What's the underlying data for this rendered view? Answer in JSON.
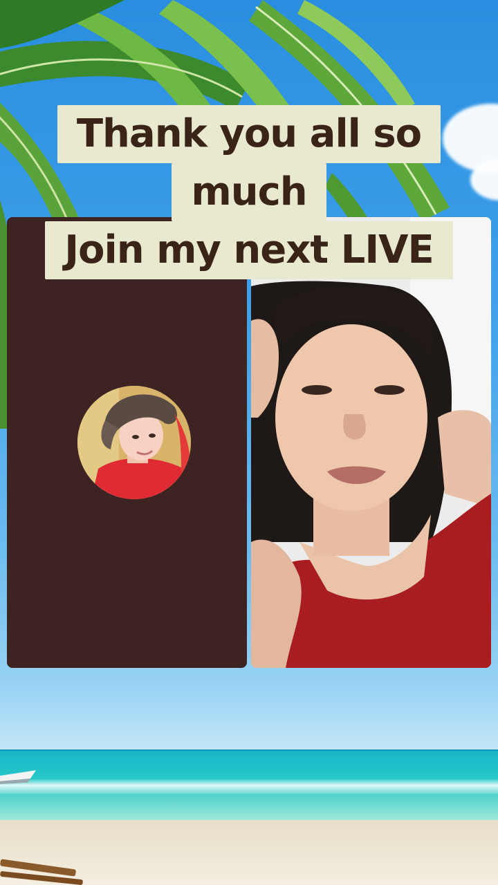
{
  "caption": {
    "line1": "Thank you all so",
    "line2": "much",
    "line3": "Join my next LIVE"
  },
  "call": {
    "left_participant": {
      "avatar_icon": "user-avatar",
      "panel_color": "#3d2422"
    },
    "right_participant": {
      "video_icon": "live-video-feed"
    }
  },
  "colors": {
    "caption_bg": "#e9e9cf",
    "caption_text": "#3a2417",
    "sky": "#3fa1ea",
    "sea": "#27c7c9",
    "sand": "#eee6d4"
  }
}
